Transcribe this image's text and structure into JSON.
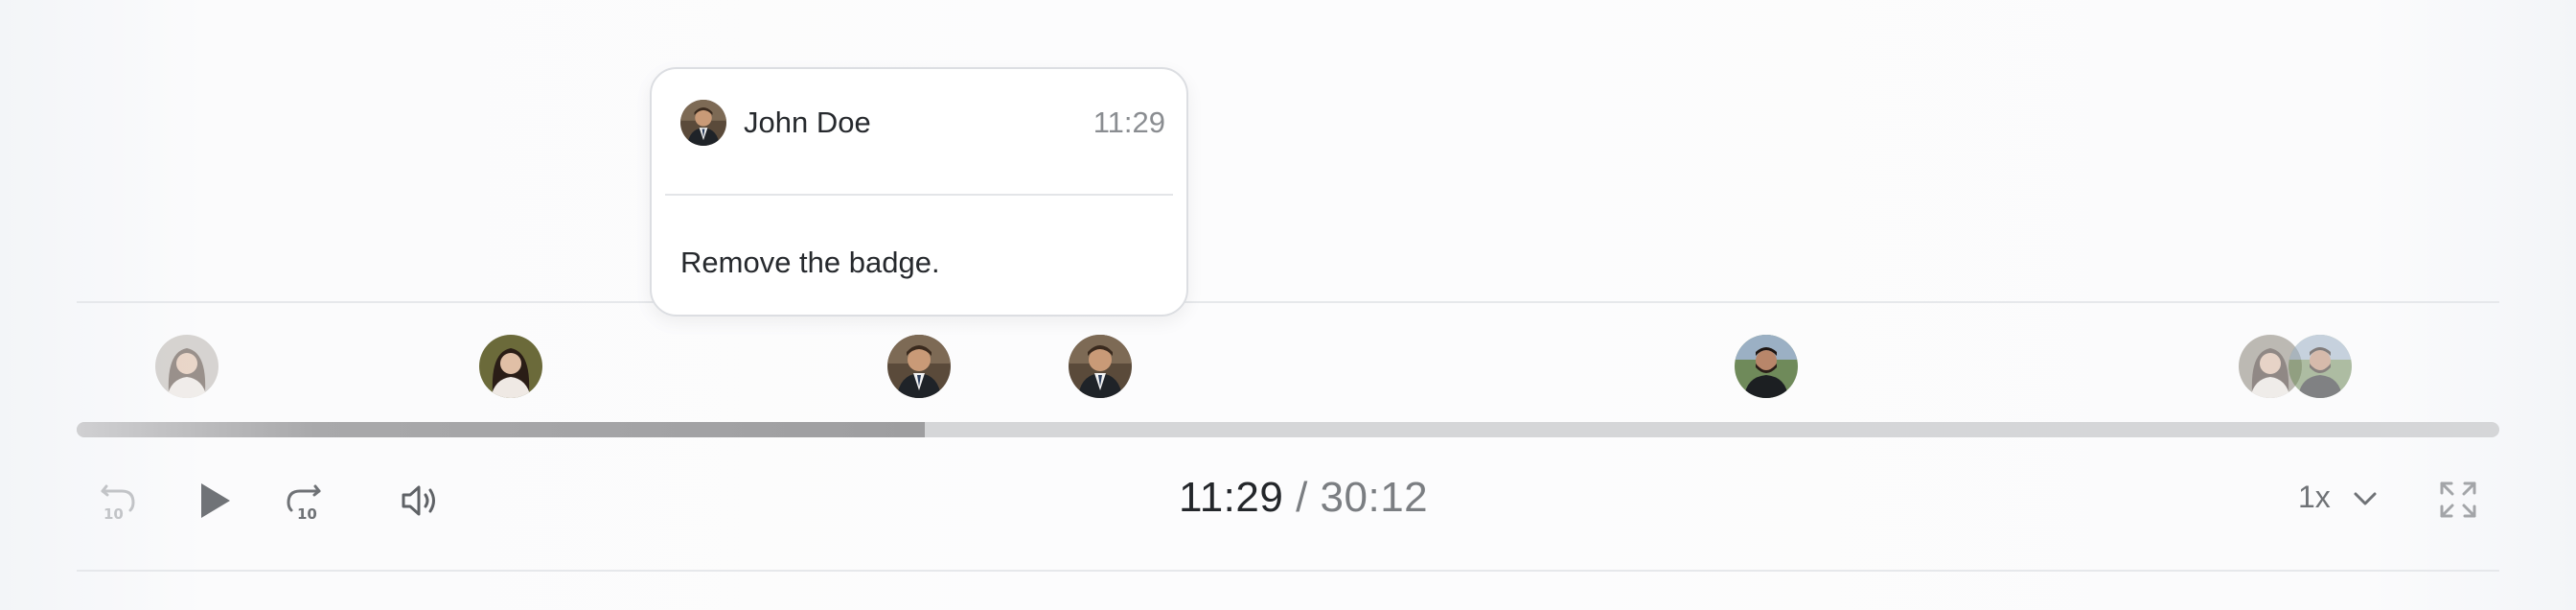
{
  "comment": {
    "author": "John Doe",
    "time": "11:29",
    "text": "Remove the badge."
  },
  "timeline": {
    "markers": [
      {
        "person": "woman-1",
        "highlighted": false
      },
      {
        "person": "woman-1",
        "highlighted": true
      },
      {
        "person": "john-doe",
        "highlighted": true
      },
      {
        "person": "john-doe",
        "highlighted": true
      },
      {
        "person": "man-2",
        "highlighted": true
      },
      {
        "person": "woman-1",
        "highlighted": false
      },
      {
        "person": "man-2",
        "highlighted": false
      }
    ],
    "progress_fraction": 0.35
  },
  "player": {
    "current_time": "11:29",
    "separator": "/",
    "duration": "30:12",
    "speed": "1x"
  },
  "icons": {
    "rewind": "rewind-10-icon",
    "play": "play-icon",
    "forward": "forward-10-icon",
    "volume": "volume-icon",
    "speed_menu": "chevron-down-icon",
    "fullscreen": "fullscreen-icon"
  },
  "colors": {
    "progress_fill": "#a3a3a5",
    "progress_track": "#d5d6d8",
    "icon": "#6f7276"
  }
}
